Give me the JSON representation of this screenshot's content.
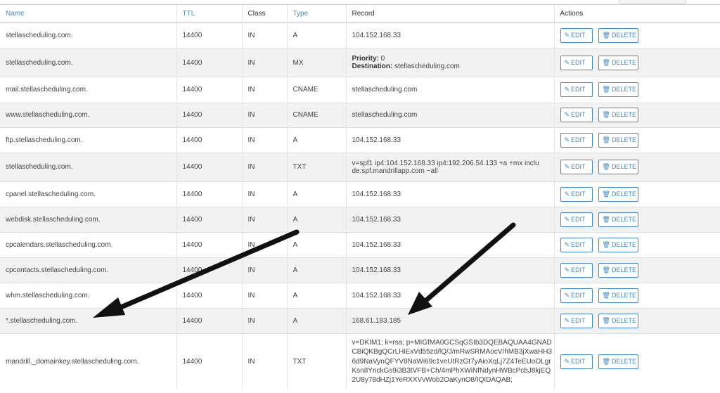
{
  "table": {
    "headers": {
      "name": "Name",
      "ttl": "TTL",
      "class": "Class",
      "type": "Type",
      "record": "Record",
      "actions": "Actions"
    },
    "rows": [
      {
        "name": "stellascheduling.com.",
        "ttl": "14400",
        "class": "IN",
        "type": "A",
        "record": "104.152.168.33"
      },
      {
        "name": "stellascheduling.com.",
        "ttl": "14400",
        "class": "IN",
        "type": "MX",
        "priority_label": "Priority:",
        "priority_value": "0",
        "destination_label": "Destination:",
        "destination_value": "stellascheduling.com"
      },
      {
        "name": "mail.stellascheduling.com.",
        "ttl": "14400",
        "class": "IN",
        "type": "CNAME",
        "record": "stellascheduling.com"
      },
      {
        "name": "www.stellascheduling.com.",
        "ttl": "14400",
        "class": "IN",
        "type": "CNAME",
        "record": "stellascheduling.com"
      },
      {
        "name": "ftp.stellascheduling.com.",
        "ttl": "14400",
        "class": "IN",
        "type": "A",
        "record": "104.152.168.33"
      },
      {
        "name": "stellascheduling.com.",
        "ttl": "14400",
        "class": "IN",
        "type": "TXT",
        "record_lines": [
          "v=spf1 ip4:104.152.168.33 ip4:192.206.54.133 +a +mx inclu",
          "de:spf.mandrillapp.com ~all"
        ]
      },
      {
        "name": "cpanel.stellascheduling.com.",
        "ttl": "14400",
        "class": "IN",
        "type": "A",
        "record": "104.152.168.33"
      },
      {
        "name": "webdisk.stellascheduling.com.",
        "ttl": "14400",
        "class": "IN",
        "type": "A",
        "record": "104.152.168.33"
      },
      {
        "name": "cpcalendars.stellascheduling.com.",
        "ttl": "14400",
        "class": "IN",
        "type": "A",
        "record": "104.152.168.33"
      },
      {
        "name": "cpcontacts.stellascheduling.com.",
        "ttl": "14400",
        "class": "IN",
        "type": "A",
        "record": "104.152.168.33"
      },
      {
        "name": "whm.stellascheduling.com.",
        "ttl": "14400",
        "class": "IN",
        "type": "A",
        "record": "104.152.168.33"
      },
      {
        "name": "*.stellascheduling.com.",
        "ttl": "14400",
        "class": "IN",
        "type": "A",
        "record": "168.61.183.185"
      },
      {
        "name": "mandrill._domainkey.stellascheduling.com.",
        "ttl": "14400",
        "class": "IN",
        "type": "TXT",
        "record": "v=DKIM1; k=rsa; p=MIGfMA0GCSqGSIb3DQEBAQUAA4GNADCBiQKBgQCrLHiExVd55zd/lQ/J/mRwSRMAocV/hMB3jXwaHH36d9NaVynQFYV8NaWi69c1veUtRzGt7yAioXqLj7Z4TeEUoOLgrKsn8YnckGs9i3B3tVFB+Ch/4mPhXWiNfNdynHWBcPcbJ8kjEQ2U8y78dHZj1YeRXXVvWob2OaKynO8/IQIDAQAB;"
      }
    ]
  },
  "buttons": {
    "edit_label": "EDIT",
    "delete_label": "DELETE",
    "edit_icon": "pencil-icon",
    "delete_icon": "trash-icon"
  },
  "colors": {
    "accent": "#3d8ac8",
    "row_alt": "#f2f2f2",
    "arrow": "#111111"
  }
}
